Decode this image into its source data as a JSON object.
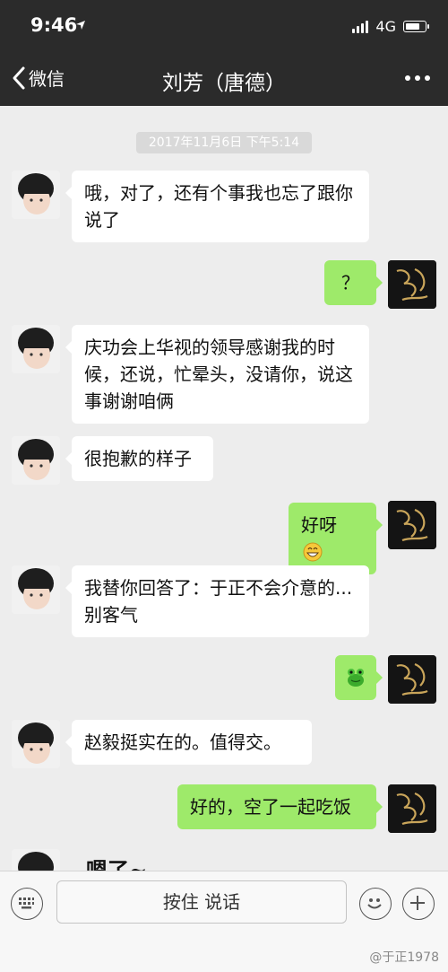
{
  "status_bar": {
    "time": "9:46",
    "network": "4G",
    "battery_level": 0.8
  },
  "nav": {
    "back_label": "微信",
    "title": "刘芳（唐德）"
  },
  "chat": {
    "timestamp": "2017年11月6日 下午5:14",
    "messages": [
      {
        "side": "in",
        "text": "哦，对了，还有个事我也忘了跟你说了"
      },
      {
        "side": "out",
        "text": "？"
      },
      {
        "side": "in",
        "text": "庆功会上华视的领导感谢我的时候，还说，忙晕头，没请你，说这事谢谢咱俩"
      },
      {
        "side": "in",
        "text": "很抱歉的样子"
      },
      {
        "side": "out",
        "text": "好呀",
        "emoji": "grin-emoji"
      },
      {
        "side": "in",
        "text": "我替你回答了：于正不会介意的...别客气"
      },
      {
        "side": "out",
        "text": "",
        "emoji": "frog-emoji"
      },
      {
        "side": "in",
        "text": "赵毅挺实在的。值得交。"
      },
      {
        "side": "out",
        "text": "好的，空了一起吃饭"
      },
      {
        "side": "in",
        "text": "嗯了~"
      }
    ]
  },
  "input_bar": {
    "talk_label": "按住 说话"
  },
  "watermark": "@于正1978",
  "colors": {
    "header": "#2b2b2b",
    "chat_bg": "#ededed",
    "out_bubble": "#9eea6a",
    "in_bubble": "#ffffff"
  }
}
